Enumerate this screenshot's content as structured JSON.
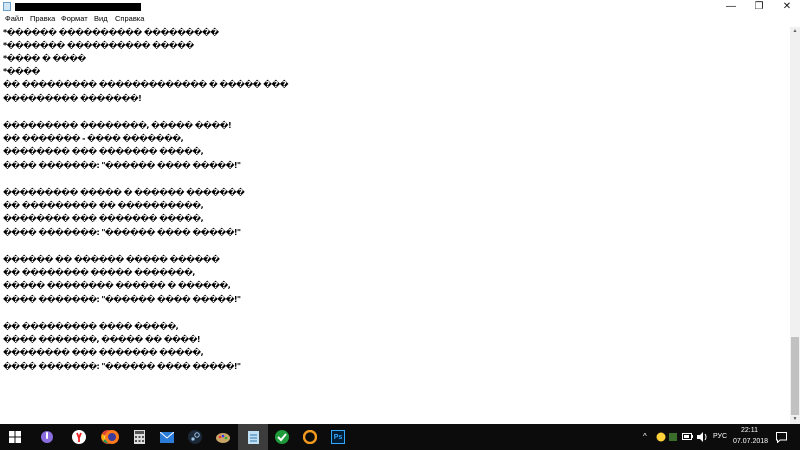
{
  "titlebar": {
    "app_icon": "notepad-icon",
    "minimize_icon": "minimize-icon",
    "maximize_icon": "restore-icon",
    "close_icon": "close-icon",
    "minimize_glyph": "—",
    "maximize_glyph": "❐",
    "close_glyph": "✕"
  },
  "menu": [
    "Файл",
    "Правка",
    "Формат",
    "Вид",
    "Справка"
  ],
  "editor": {
    "lines": [
      "*������ ���������� ���������",
      "*������� ���������� �����",
      "*���� � ����",
      "*����",
      "�� ��������� ������������� � ����� ���",
      "��������� �������!",
      "",
      "��������� ��������, ����� ����!",
      "�� ������� - ���� �������,",
      "�������� ��� ������� �����,",
      "���� �������: \"������ ���� �����!\"",
      "",
      "��������� ����� � ������ �������",
      "�� ��������� �� ����������,",
      "�������� ��� ������� �����,",
      "���� �������: \"������ ���� �����!\"",
      "",
      "������ �� ������ ����� ������",
      "�� �������� ����� �������,",
      "����� �������� ������ � ������,",
      "���� �������: \"������ ���� �����!\"",
      "",
      "�� ��������� ���� �����,",
      "���� �������, ����� �� ����!",
      "�������� ��� ������� �����,",
      "���� �������: \"������ ���� �����!\""
    ]
  },
  "taskbar": {
    "icons": [
      "windows-start-icon",
      "cortana-icon",
      "yandex-browser-icon",
      "chrome-icon",
      "firefox-icon",
      "calculator-icon",
      "mail-icon",
      "steam-icon",
      "paint-icon",
      "notepad-icon",
      "green-app-icon",
      "orange-app-icon",
      "photoshop-icon"
    ],
    "photoshop_label": "Ps",
    "tray": {
      "chevron": "^",
      "language": "РУС",
      "time": "22:11",
      "date": "07.07.2018"
    }
  }
}
